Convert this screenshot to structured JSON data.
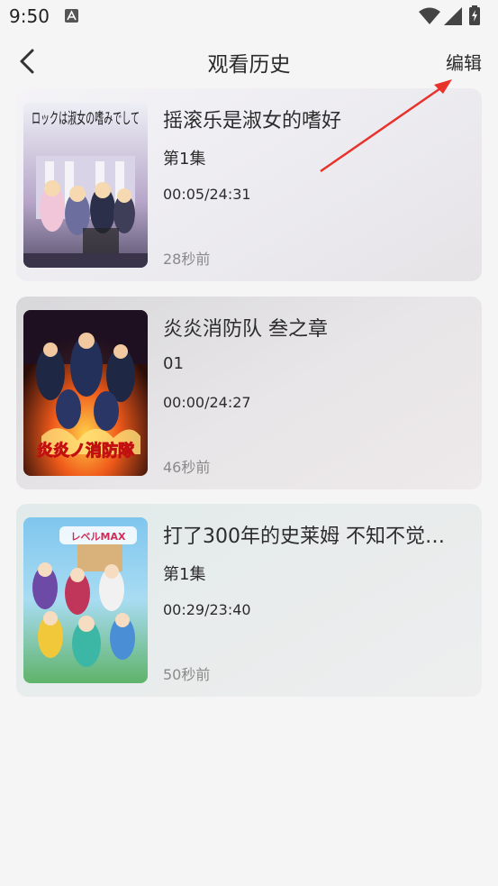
{
  "status_bar": {
    "time": "9:50"
  },
  "header": {
    "title": "观看历史",
    "edit_label": "编辑"
  },
  "history": [
    {
      "title": "摇滚乐是淑女的嗜好",
      "episode": "第1集",
      "progress": "00:05/24:31",
      "watched_ago": "28秒前",
      "poster_text": "ロックは淑女の嗜みでして"
    },
    {
      "title": "炎炎消防队 叁之章",
      "episode": "01",
      "progress": "00:00/24:27",
      "watched_ago": "46秒前",
      "poster_text": "炎炎ノ消防隊"
    },
    {
      "title": "打了300年的史莱姆 不知不觉…",
      "episode": "第1集",
      "progress": "00:29/23:40",
      "watched_ago": "50秒前",
      "poster_text": "レベルMAX"
    }
  ],
  "colors": {
    "accent_arrow": "#e8322b"
  }
}
